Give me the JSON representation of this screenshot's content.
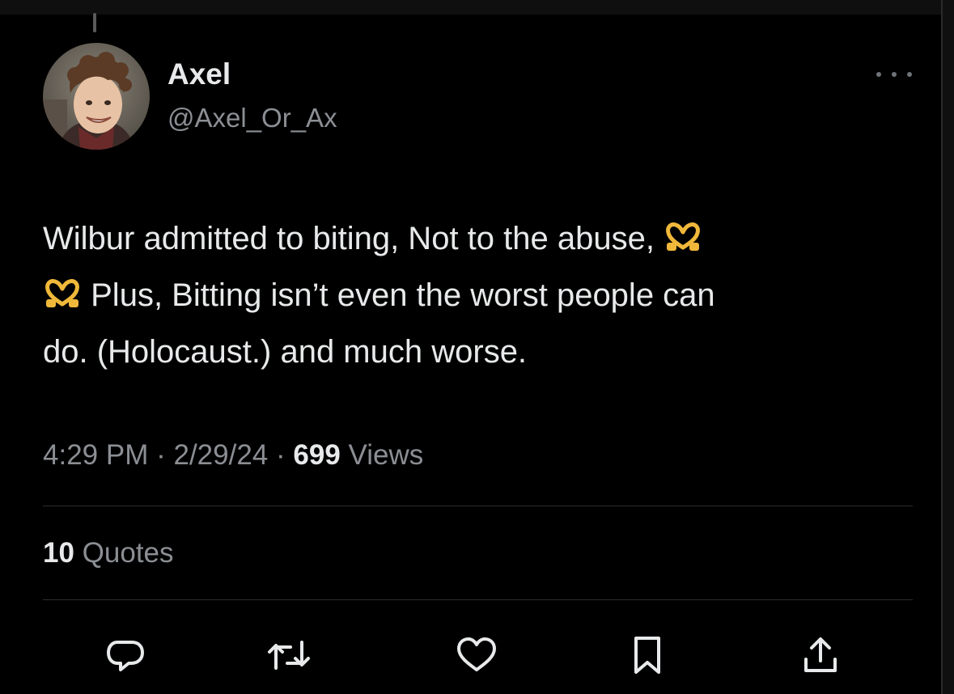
{
  "author": {
    "name": "Axel",
    "handle": "@Axel_Or_Ax"
  },
  "tweet": {
    "line1": "Wilbur admitted to biting, Not to the abuse,",
    "line2": "Plus, Bitting isn’t even the worst people can",
    "line3": "do. (Holocaust.) and much worse.",
    "emoji": "heart-hands-emoji"
  },
  "meta": {
    "time": "4:29 PM",
    "separator": "·",
    "date": "2/29/24",
    "views_count": "699",
    "views_label": "Views"
  },
  "stats": {
    "quotes_count": "10",
    "quotes_label": "Quotes"
  },
  "actions": [
    "reply-icon",
    "retweet-icon",
    "like-icon",
    "bookmark-icon",
    "share-icon"
  ],
  "colors": {
    "background": "#000000",
    "primary_text": "#e7e9ea",
    "secondary_text": "#8b8f94",
    "divider": "#2a2d31",
    "emoji": "#f0b83a"
  }
}
